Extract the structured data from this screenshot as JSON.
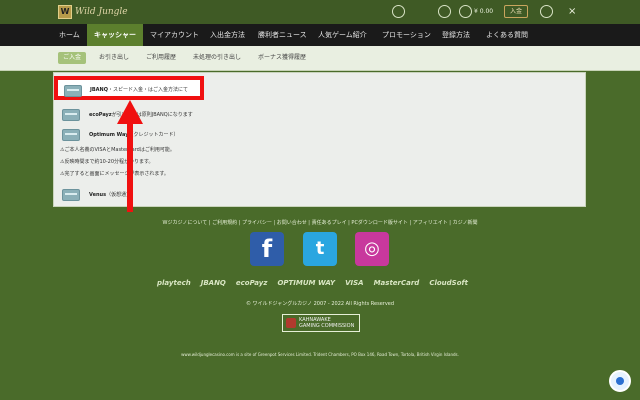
{
  "header": {
    "logo_badge": "W",
    "logo_text": "Wild Jungle",
    "balance": "¥ 0.00",
    "login_label": "入金",
    "close_label": "×",
    "icons": [
      "support-icon",
      "gift-icon",
      "wallet-icon",
      "globe-icon",
      "close-icon"
    ]
  },
  "nav": {
    "items": [
      "ホーム",
      "キャッシャー",
      "マイアカウント",
      "入出金方法",
      "勝利者ニュース",
      "人気ゲーム紹介",
      "プロモーション",
      "登録方法",
      "よくある質問"
    ],
    "active_index": 1
  },
  "subnav": {
    "items": [
      "ご入金",
      "お引き出し",
      "ご利用履歴",
      "未処理の引き出し",
      "ボーナス獲得履歴"
    ],
    "active_index": 0
  },
  "payments": [
    {
      "name": "JBANQ",
      "desc": "・スピード入金・はご入金方法にて"
    },
    {
      "name": "ecoPayz",
      "desc": "が引出処理は原則JBANQになります"
    },
    {
      "name": "Optimum Way",
      "desc": "（クレジットカード）"
    },
    {
      "name": "Venus",
      "desc": "（仮想通貨）"
    }
  ],
  "notes": [
    "⚠ご本人名義のVISAとMasterCardはご利用可能。",
    "⚠反映時間まで約10-20分程かかります。",
    "⚠完了すると画面にメッセージが表示されます。"
  ],
  "footer": {
    "links": "Wジカジノについて | ご利用規約 | プライバシー | お問い合わせ | 責任あるプレイ | PCダウンロード版サイト | アフィリエイト | カジノ新聞",
    "social": {
      "fb": "f",
      "tw": "t",
      "ig": "◎"
    },
    "providers": [
      "playtech",
      "JBANQ",
      "ecoPayz",
      "OPTIMUM WAY",
      "VISA",
      "MasterCard",
      "CloudSoft"
    ],
    "copyright": "© ワイルドジャングルカジノ 2007 - 2022 All Rights Reserved",
    "kahnawake": [
      "KAHNAWAKE",
      "GAMING COMMISSION"
    ],
    "address": "www.wildjunglecasino.com is a site of Greenpot Services Limited. Trident Chambers, PO Box 146, Road Town, Tortola, British Virgin Islands."
  },
  "colors": {
    "nav_active": "#5c7f2d",
    "highlight": "#f01010",
    "background": "#4a6b2a"
  }
}
